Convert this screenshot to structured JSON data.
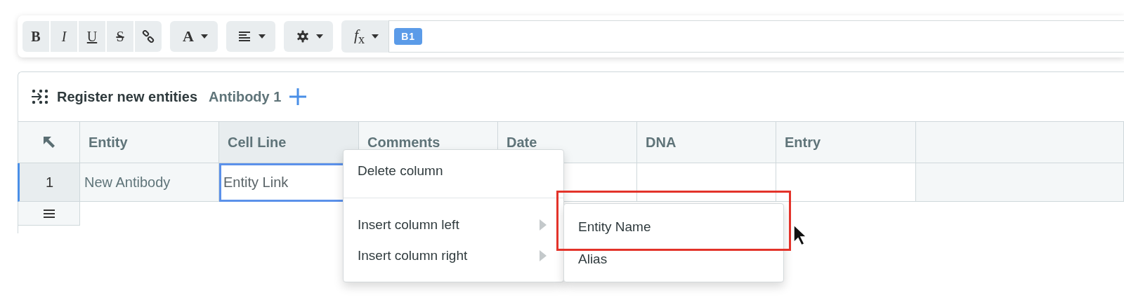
{
  "toolbar": {
    "format_buttons": [
      {
        "kind": "bold",
        "label": "B"
      },
      {
        "kind": "italic",
        "label": "I"
      },
      {
        "kind": "underline",
        "label": "U"
      },
      {
        "kind": "strike",
        "label": "S"
      },
      {
        "kind": "link"
      }
    ],
    "dropdowns": [
      {
        "kind": "text-color",
        "label": "A"
      },
      {
        "kind": "align"
      },
      {
        "kind": "settings"
      },
      {
        "kind": "function",
        "label": "*f*$_{x}$"
      }
    ],
    "formula": {
      "cell_ref": "B1"
    }
  },
  "panel": {
    "title": "Register new entities",
    "tab": "Antibody 1"
  },
  "table": {
    "columns": [
      {
        "label": "Entity",
        "selected": false
      },
      {
        "label": "Cell Line",
        "selected": true
      },
      {
        "label": "Comments",
        "selected": false
      },
      {
        "label": "Date",
        "selected": false
      },
      {
        "label": "DNA",
        "selected": false
      },
      {
        "label": "Entry",
        "selected": false
      }
    ],
    "rows": [
      {
        "number": "1",
        "selected": true,
        "cells": [
          {
            "text": "New Antibody",
            "active": false
          },
          {
            "text": "Entity Link",
            "active": true
          }
        ]
      }
    ]
  },
  "context_menu": {
    "groups": [
      [
        {
          "label": "Delete column",
          "submenu": false
        }
      ],
      [
        {
          "label": "Insert column left",
          "submenu": true
        },
        {
          "label": "Insert column right",
          "submenu": true
        }
      ]
    ]
  },
  "submenu": {
    "items": [
      {
        "label": "Entity Name",
        "highlighted": true
      },
      {
        "label": "Alias",
        "highlighted": false
      }
    ]
  }
}
